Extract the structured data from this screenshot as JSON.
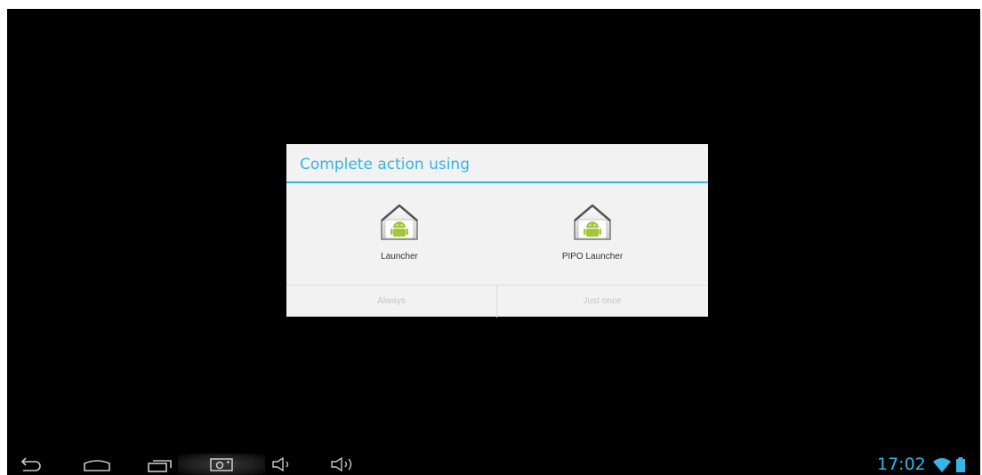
{
  "dialog": {
    "title": "Complete action using",
    "options": [
      {
        "label": "Launcher",
        "icon": "android-home-icon"
      },
      {
        "label": "PIPO Launcher",
        "icon": "android-home-icon"
      }
    ],
    "buttons": {
      "always": "Always",
      "just_once": "Just once"
    }
  },
  "navbar": {
    "buttons": [
      "back-icon",
      "home-icon",
      "recent-apps-icon",
      "screenshot-icon",
      "volume-down-icon",
      "volume-up-icon"
    ]
  },
  "status": {
    "time": "17:02",
    "icons": [
      "wifi-icon",
      "battery-icon"
    ]
  },
  "colors": {
    "accent": "#33b5e5",
    "dialog_bg": "#f2f2f2",
    "screen_bg": "#000000",
    "android_green": "#a4c639"
  }
}
